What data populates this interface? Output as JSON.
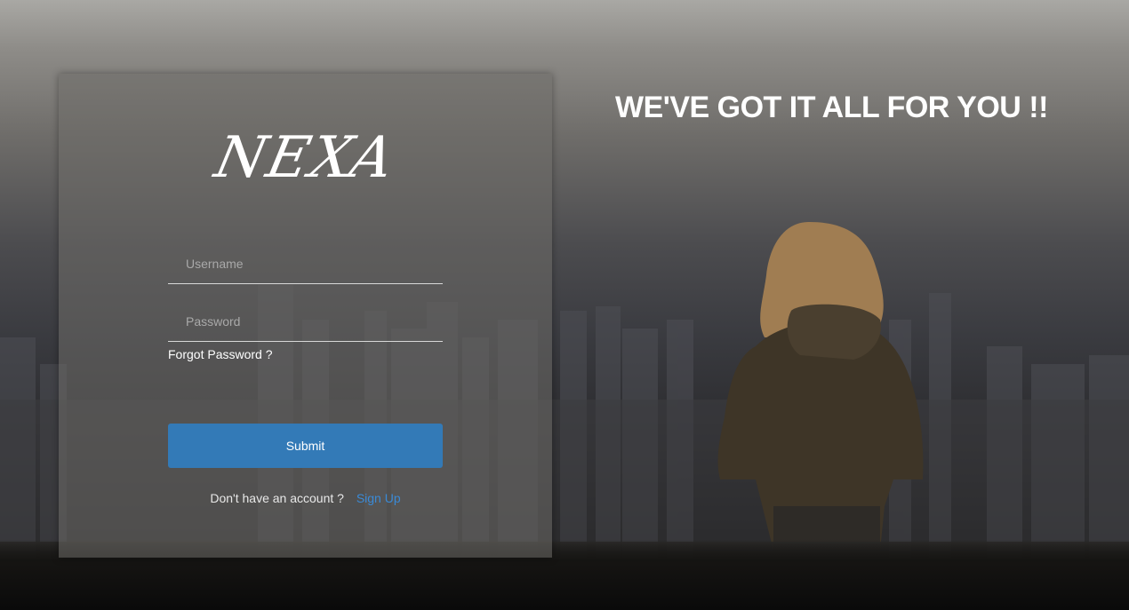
{
  "brand": {
    "logo_text": "NEXA"
  },
  "login_form": {
    "username_placeholder": "Username",
    "password_placeholder": "Password",
    "forgot_label": "Forgot Password ?",
    "submit_label": "Submit",
    "signup_prompt": "Don't have an account ?",
    "signup_label": "Sign Up"
  },
  "hero": {
    "headline": "WE'VE GOT IT ALL FOR YOU !!"
  },
  "colors": {
    "primary": "#337ab7",
    "link": "#3a8ad6",
    "text": "#ffffff"
  }
}
